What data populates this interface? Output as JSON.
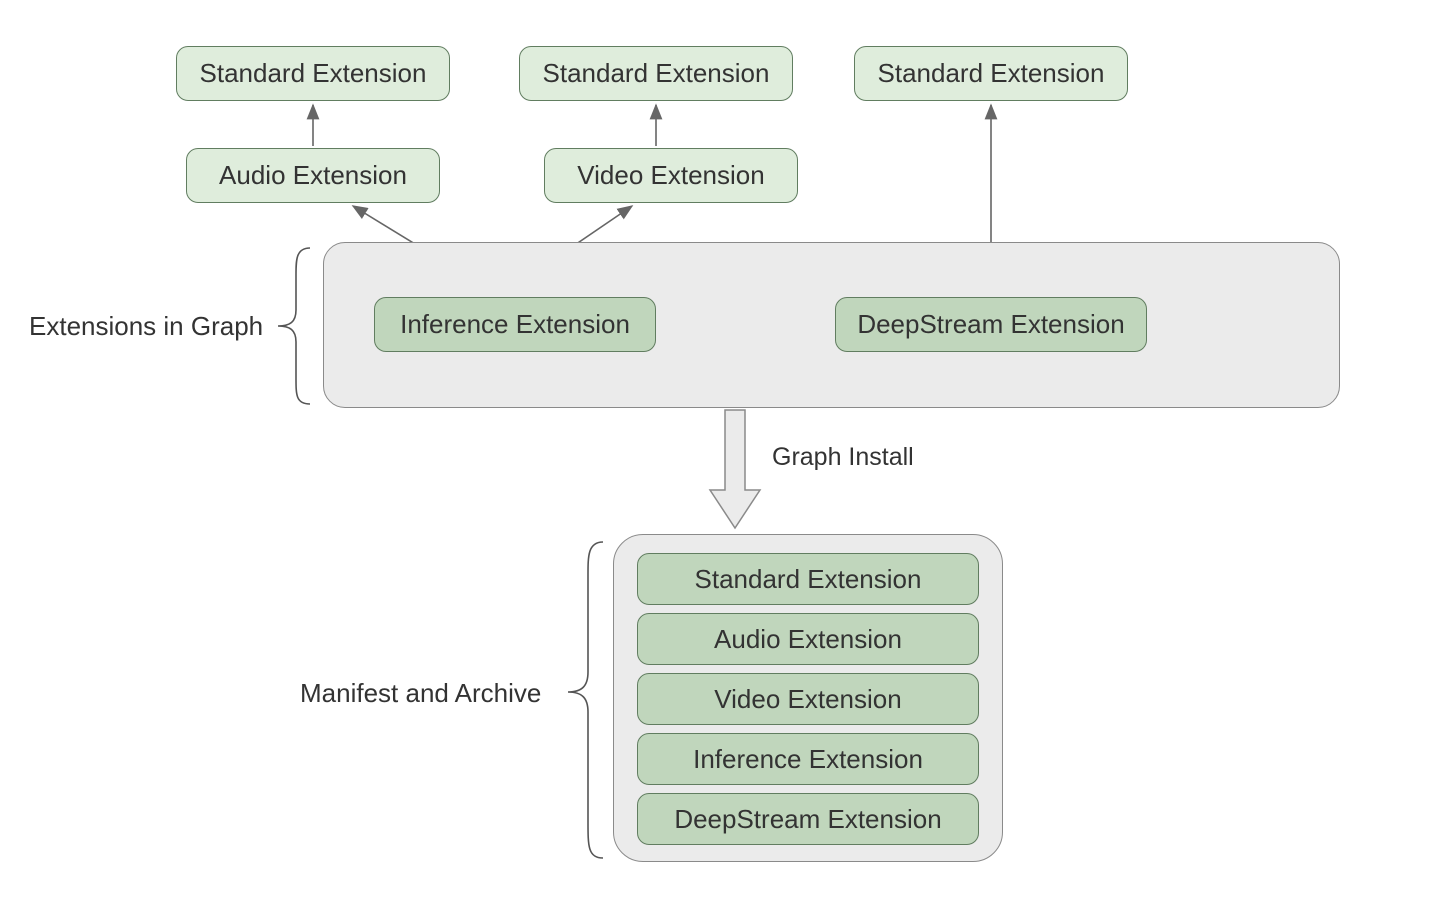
{
  "top": {
    "std1": "Standard Extension",
    "std2": "Standard Extension",
    "std3": "Standard Extension",
    "audio": "Audio Extension",
    "video": "Video Extension"
  },
  "graph": {
    "label": "Extensions in Graph",
    "inference": "Inference Extension",
    "deepstream": "DeepStream Extension"
  },
  "arrowLabel": "Graph Install",
  "archive": {
    "label": "Manifest and Archive",
    "items": [
      "Standard Extension",
      "Audio Extension",
      "Video Extension",
      "Inference Extension",
      "DeepStream Extension"
    ]
  },
  "colors": {
    "greenLightFill": "#dfeddc",
    "greenDarkFill": "#c0d6bc",
    "greenBorder": "#617d60",
    "grayFill": "#ebebeb",
    "grayBorder": "#8a8a8a",
    "arrow": "#666666"
  }
}
